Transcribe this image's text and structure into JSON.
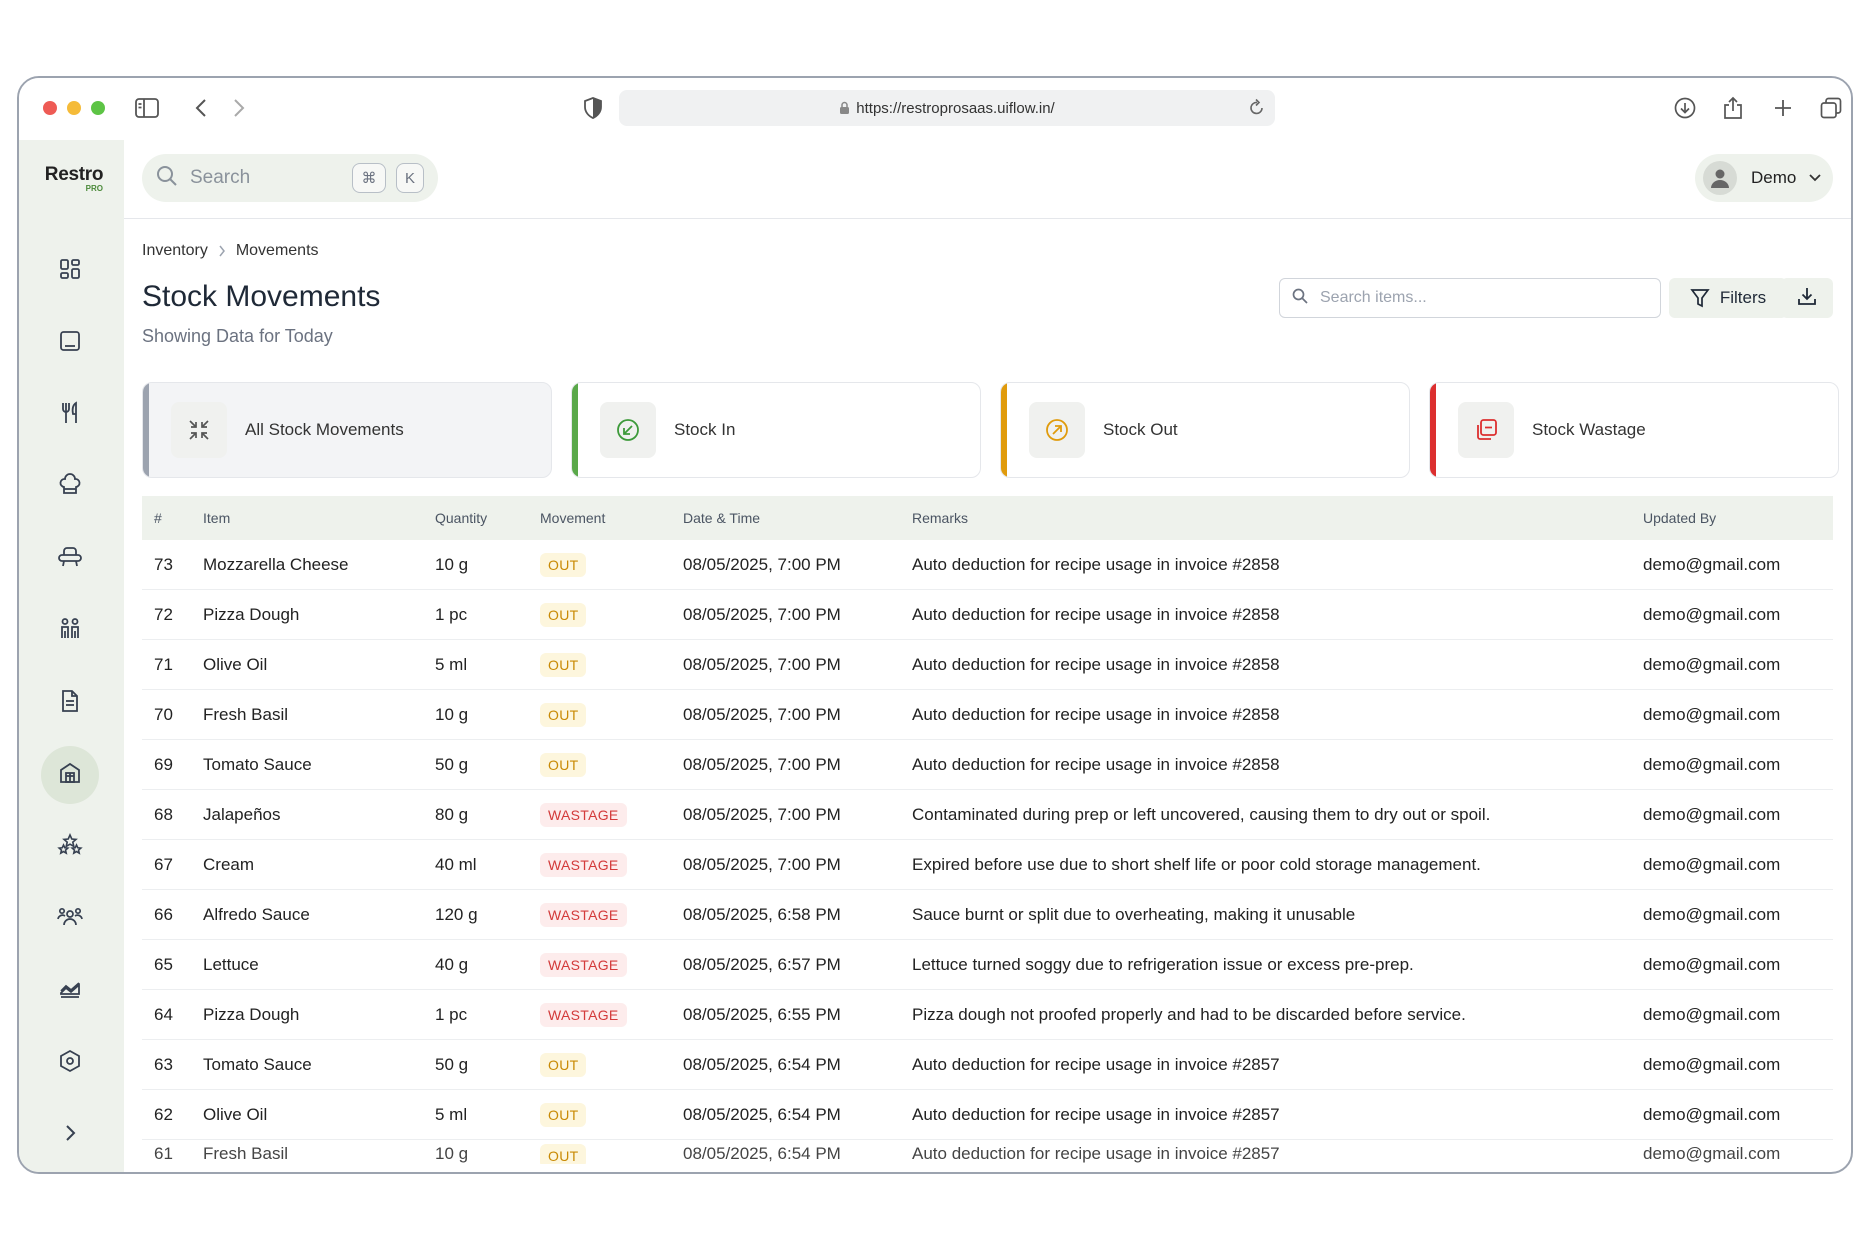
{
  "browser": {
    "url": "https://restroprosaas.uiflow.in/"
  },
  "logo": {
    "word": "Restro",
    "badge": "PRO"
  },
  "sidebar": {
    "items": [
      {
        "icon": "dashboard-icon"
      },
      {
        "icon": "tablet-icon"
      },
      {
        "icon": "fork-knife-icon"
      },
      {
        "icon": "chef-hat-icon"
      },
      {
        "icon": "armchair-icon"
      },
      {
        "icon": "people-icon"
      },
      {
        "icon": "document-icon"
      },
      {
        "icon": "warehouse-icon"
      },
      {
        "icon": "stars-icon"
      },
      {
        "icon": "users-group-icon"
      },
      {
        "icon": "chart-icon"
      },
      {
        "icon": "settings-hexagon-icon"
      },
      {
        "icon": "chevron-right-icon"
      }
    ],
    "active_index": 7
  },
  "topbar": {
    "search_placeholder": "Search",
    "shortcut_cmd": "⌘",
    "shortcut_key": "K",
    "user_name": "Demo"
  },
  "breadcrumb": {
    "parent": "Inventory",
    "current": "Movements"
  },
  "page": {
    "title": "Stock Movements",
    "subtitle": "Showing Data for Today",
    "search_placeholder": "Search items...",
    "filters_label": "Filters"
  },
  "cards": [
    {
      "label": "All Stock Movements",
      "color": "#9ca3af",
      "icon": "collapse-arrows-icon"
    },
    {
      "label": "Stock In",
      "color": "#5aa84a",
      "icon": "arrow-in-circle-icon"
    },
    {
      "label": "Stock Out",
      "color": "#e09b0c",
      "icon": "arrow-out-circle-icon"
    },
    {
      "label": "Stock Wastage",
      "color": "#dc2f2f",
      "icon": "wastage-icon"
    }
  ],
  "table": {
    "headers": {
      "num": "#",
      "item": "Item",
      "quantity": "Quantity",
      "movement": "Movement",
      "datetime": "Date & Time",
      "remarks": "Remarks",
      "updated_by": "Updated By"
    },
    "rows": [
      {
        "num": "73",
        "item": "Mozzarella Cheese",
        "qty": "10 g",
        "movement": "OUT",
        "datetime": "08/05/2025, 7:00 PM",
        "remarks": "Auto deduction for recipe usage in invoice #2858",
        "updated_by": "demo@gmail.com"
      },
      {
        "num": "72",
        "item": "Pizza Dough",
        "qty": "1 pc",
        "movement": "OUT",
        "datetime": "08/05/2025, 7:00 PM",
        "remarks": "Auto deduction for recipe usage in invoice #2858",
        "updated_by": "demo@gmail.com"
      },
      {
        "num": "71",
        "item": "Olive Oil",
        "qty": "5 ml",
        "movement": "OUT",
        "datetime": "08/05/2025, 7:00 PM",
        "remarks": "Auto deduction for recipe usage in invoice #2858",
        "updated_by": "demo@gmail.com"
      },
      {
        "num": "70",
        "item": "Fresh Basil",
        "qty": "10 g",
        "movement": "OUT",
        "datetime": "08/05/2025, 7:00 PM",
        "remarks": "Auto deduction for recipe usage in invoice #2858",
        "updated_by": "demo@gmail.com"
      },
      {
        "num": "69",
        "item": "Tomato Sauce",
        "qty": "50 g",
        "movement": "OUT",
        "datetime": "08/05/2025, 7:00 PM",
        "remarks": "Auto deduction for recipe usage in invoice #2858",
        "updated_by": "demo@gmail.com"
      },
      {
        "num": "68",
        "item": "Jalapeños",
        "qty": "80 g",
        "movement": "WASTAGE",
        "datetime": "08/05/2025, 7:00 PM",
        "remarks": "Contaminated during prep or left uncovered, causing them to dry out or spoil.",
        "updated_by": "demo@gmail.com"
      },
      {
        "num": "67",
        "item": "Cream",
        "qty": "40 ml",
        "movement": "WASTAGE",
        "datetime": "08/05/2025, 7:00 PM",
        "remarks": "Expired before use due to short shelf life or poor cold storage management.",
        "updated_by": "demo@gmail.com"
      },
      {
        "num": "66",
        "item": "Alfredo Sauce",
        "qty": "120 g",
        "movement": "WASTAGE",
        "datetime": "08/05/2025, 6:58 PM",
        "remarks": "Sauce burnt or split due to overheating, making it unusable",
        "updated_by": "demo@gmail.com"
      },
      {
        "num": "65",
        "item": "Lettuce",
        "qty": "40 g",
        "movement": "WASTAGE",
        "datetime": "08/05/2025, 6:57 PM",
        "remarks": "Lettuce turned soggy due to refrigeration issue or excess pre-prep.",
        "updated_by": "demo@gmail.com"
      },
      {
        "num": "64",
        "item": "Pizza Dough",
        "qty": "1 pc",
        "movement": "WASTAGE",
        "datetime": "08/05/2025, 6:55 PM",
        "remarks": "Pizza dough not proofed properly and had to be discarded before service.",
        "updated_by": "demo@gmail.com"
      },
      {
        "num": "63",
        "item": "Tomato Sauce",
        "qty": "50 g",
        "movement": "OUT",
        "datetime": "08/05/2025, 6:54 PM",
        "remarks": "Auto deduction for recipe usage in invoice #2857",
        "updated_by": "demo@gmail.com"
      },
      {
        "num": "62",
        "item": "Olive Oil",
        "qty": "5 ml",
        "movement": "OUT",
        "datetime": "08/05/2025, 6:54 PM",
        "remarks": "Auto deduction for recipe usage in invoice #2857",
        "updated_by": "demo@gmail.com"
      },
      {
        "num": "61",
        "item": "Fresh Basil",
        "qty": "10 g",
        "movement": "OUT",
        "datetime": "08/05/2025, 6:54 PM",
        "remarks": "Auto deduction for recipe usage in invoice #2857",
        "updated_by": "demo@gmail.com"
      }
    ]
  }
}
